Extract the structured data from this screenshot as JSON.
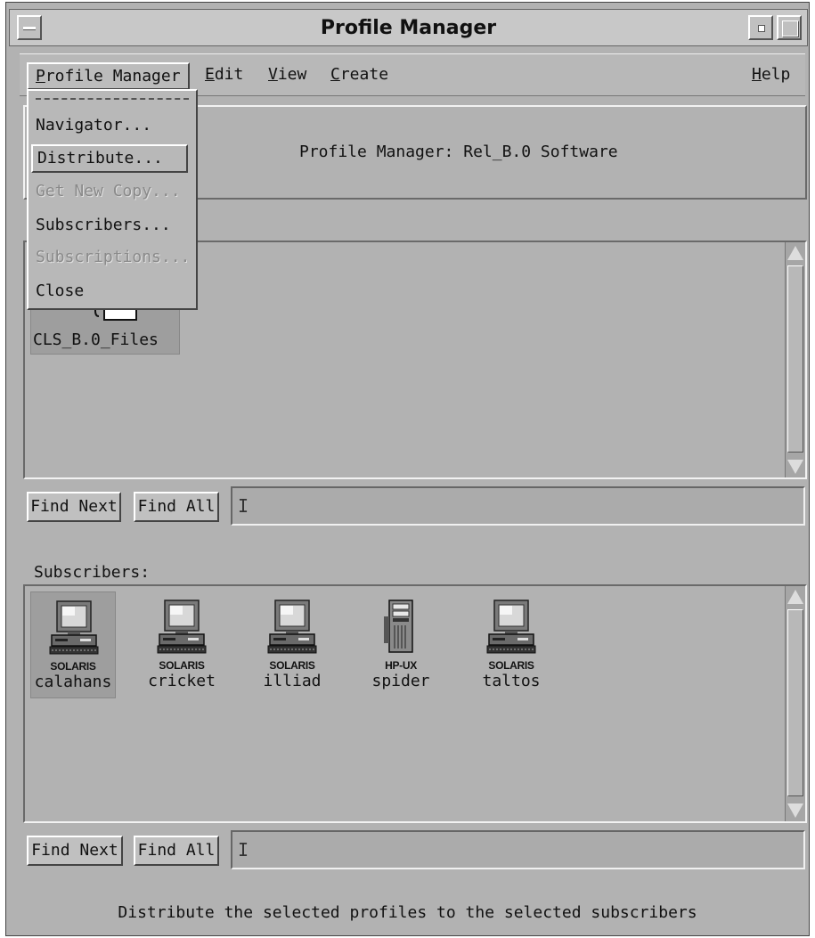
{
  "window": {
    "title": "Profile Manager"
  },
  "menubar": {
    "items": [
      {
        "label": "Profile Manager",
        "mnemonic": "P"
      },
      {
        "label": "Edit",
        "mnemonic": "E"
      },
      {
        "label": "View",
        "mnemonic": "V"
      },
      {
        "label": "Create",
        "mnemonic": "C"
      },
      {
        "label": "Help",
        "mnemonic": "H"
      }
    ]
  },
  "dropdown": {
    "items": [
      {
        "label": "Navigator...",
        "enabled": true
      },
      {
        "label": "Distribute...",
        "enabled": true,
        "highlighted": true
      },
      {
        "label": "Get New Copy...",
        "enabled": false
      },
      {
        "label": "Subscribers...",
        "enabled": true
      },
      {
        "label": "Subscriptions...",
        "enabled": false
      },
      {
        "label": "Close",
        "enabled": true
      }
    ]
  },
  "header": {
    "text": "Profile Manager: Rel_B.0 Software"
  },
  "profiles": {
    "items": [
      {
        "label": "CLS_B.0_Files",
        "selected": true
      }
    ]
  },
  "find_bar_1": {
    "find_next": "Find Next",
    "find_all": "Find All",
    "value": ""
  },
  "subscribers": {
    "heading": "Subscribers:",
    "items": [
      {
        "os": "SOLARIS",
        "name": "calahans",
        "icon": "workstation-icon",
        "selected": true
      },
      {
        "os": "SOLARIS",
        "name": "cricket",
        "icon": "workstation-icon"
      },
      {
        "os": "SOLARIS",
        "name": "illiad",
        "icon": "workstation-icon"
      },
      {
        "os": "HP-UX",
        "name": "spider",
        "icon": "server-tower-icon"
      },
      {
        "os": "SOLARIS",
        "name": "taltos",
        "icon": "workstation-icon"
      }
    ]
  },
  "find_bar_2": {
    "find_next": "Find Next",
    "find_all": "Find All",
    "value": ""
  },
  "status": {
    "text": "Distribute the selected profiles to the selected subscribers"
  },
  "colors": {
    "background": "#b2b2b2",
    "highlight": "#ffffff",
    "shadow": "#444444"
  }
}
